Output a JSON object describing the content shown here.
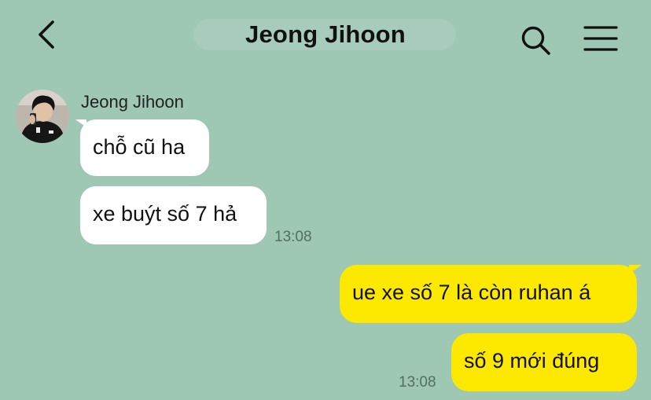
{
  "header": {
    "title": "Jeong Jihoon",
    "back_icon": "chevron-left-icon",
    "search_icon": "search-icon",
    "menu_icon": "hamburger-menu-icon"
  },
  "chat": {
    "incoming": {
      "sender_name": "Jeong Jihoon",
      "avatar": "profile-photo",
      "messages": [
        {
          "text": "chỗ cũ ha"
        },
        {
          "text": "xe buýt số 7 hả"
        }
      ],
      "time": "13:08"
    },
    "outgoing": {
      "messages": [
        {
          "text": "ue xe số 7 là còn ruhan á"
        },
        {
          "text": "số 9 mới đúng"
        }
      ],
      "time": "13:08"
    }
  },
  "colors": {
    "background": "#9ec7b4",
    "incoming_bubble": "#ffffff",
    "outgoing_bubble": "#fde800"
  }
}
